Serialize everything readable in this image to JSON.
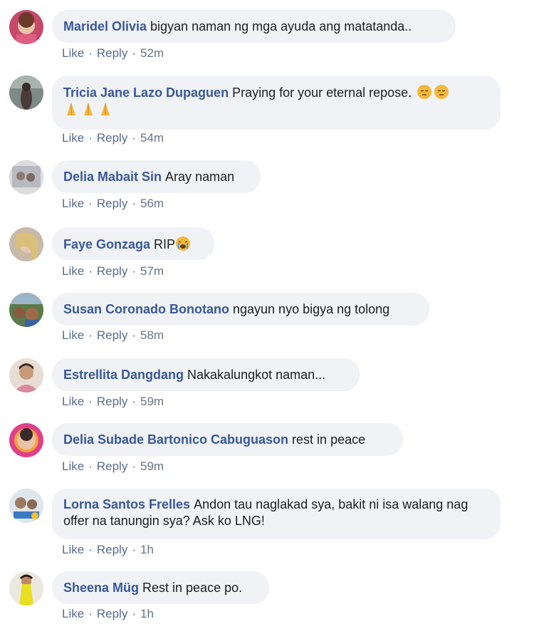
{
  "actions": {
    "like": "Like",
    "reply": "Reply",
    "separator": "·"
  },
  "comments": [
    {
      "author": "Maridel Olivia",
      "text": "bigyan naman ng mga ayuda ang matatanda..",
      "time": "52m"
    },
    {
      "author": "Tricia Jane Lazo Dupaguen",
      "text": "Praying for your eternal repose.",
      "time": "54m",
      "emojis": [
        "pensive-face-icon",
        "pensive-face-icon",
        "folded-hands-icon",
        "folded-hands-icon",
        "folded-hands-icon"
      ]
    },
    {
      "author": "Delia Mabait Sin",
      "text": "Aray naman",
      "time": "56m"
    },
    {
      "author": "Faye Gonzaga",
      "text": "RIP",
      "time": "57m",
      "emojis": [
        "crying-face-icon"
      ]
    },
    {
      "author": "Susan Coronado Bonotano",
      "text": "ngayun nyo bigya ng tolong",
      "time": "58m"
    },
    {
      "author": "Estrellita Dangdang",
      "text": "Nakakalungkot naman...",
      "time": "59m"
    },
    {
      "author": "Delia Subade Bartonico Cabuguason",
      "text": "rest in peace",
      "time": "59m"
    },
    {
      "author": "Lorna Santos Frelles",
      "text": "Andon tau naglakad sya, bakit ni isa walang nag offer na tanungin sya? Ask ko LNG!",
      "time": "1h"
    },
    {
      "author": "Sheena Müg",
      "text": "Rest in peace po.",
      "time": "1h"
    }
  ],
  "colors": {
    "author": "#385898",
    "bubble": "#f0f2f5",
    "action": "#5a6b8c"
  }
}
